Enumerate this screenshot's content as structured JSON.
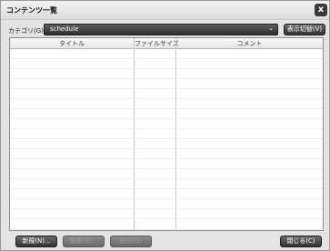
{
  "window": {
    "title": "コンテンツ一覧",
    "close_label": "x"
  },
  "category": {
    "label": "カテゴリ(G)",
    "selected": "schedule",
    "display_toggle_label": "表示切替(V)"
  },
  "table": {
    "columns": [
      "タイトル",
      "ファイルサイズ",
      "コメント"
    ],
    "rows": []
  },
  "footer": {
    "new_label": "新規(N)...",
    "edit_label": "編集(E)...",
    "delete_label": "削除(D)",
    "close_label": "閉じる(C)"
  }
}
